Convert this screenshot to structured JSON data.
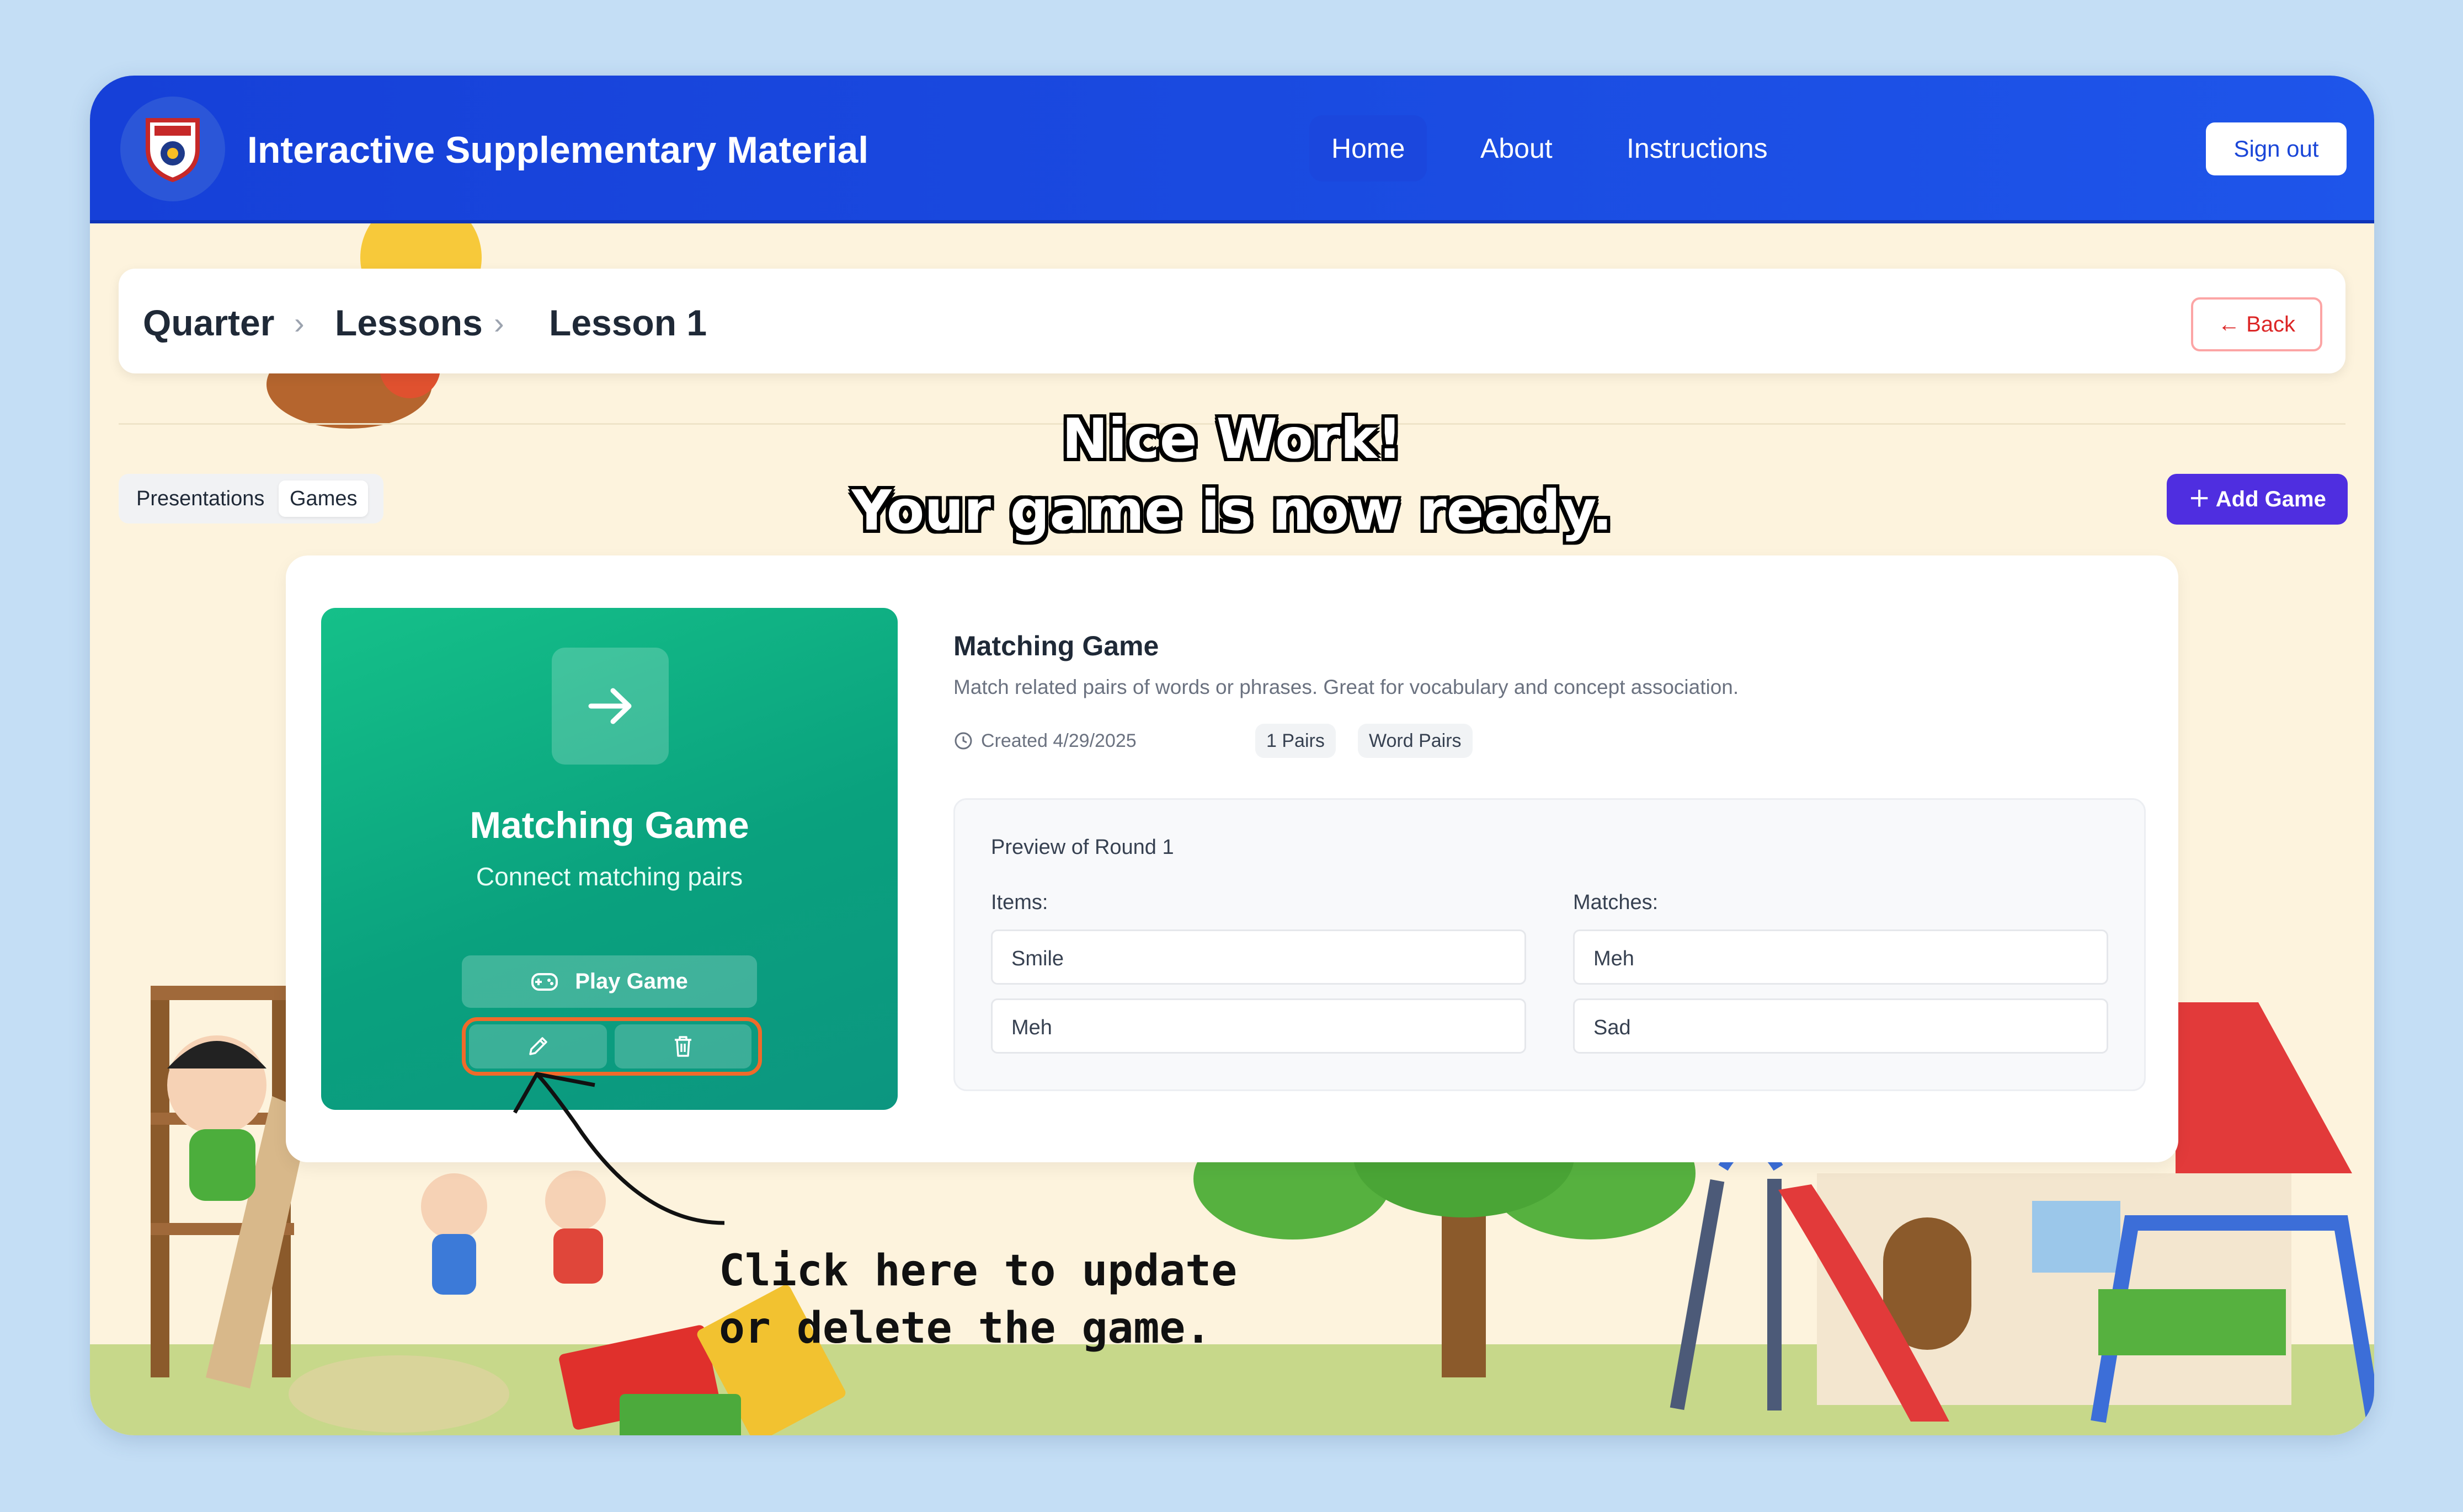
{
  "header": {
    "app_title": "Interactive Supplementary Material",
    "nav": [
      "Home",
      "About",
      "Instructions"
    ],
    "sign_out": "Sign out"
  },
  "breadcrumb": {
    "items": [
      "Quarter",
      "Lessons",
      "Lesson 1"
    ],
    "separator": "›",
    "back_label": "Back"
  },
  "tabs": [
    "Presentations",
    "Games"
  ],
  "active_tab": "Games",
  "add_game_label": "Add Game",
  "overlay": {
    "line1": "Nice Work!",
    "line2": "Your game is now ready."
  },
  "game_tile": {
    "title": "Matching Game",
    "subtitle": "Connect matching pairs",
    "play_label": "Play Game"
  },
  "game_info": {
    "title": "Matching Game",
    "description": "Match related pairs of words or phrases. Great for vocabulary and concept association.",
    "created": "Created 4/29/2025",
    "badges": [
      "1 Pairs",
      "Word Pairs"
    ]
  },
  "preview": {
    "title": "Preview of Round 1",
    "items_label": "Items:",
    "matches_label": "Matches:",
    "items": [
      "Smile",
      "Meh"
    ],
    "matches": [
      "Meh",
      "Sad"
    ]
  },
  "annotation": {
    "line1": "Click here to update",
    "line2": "or delete the game."
  },
  "colors": {
    "header_blue": "#1a46d8",
    "tile_green": "#0aa17e",
    "add_game_purple": "#4f2ee0",
    "highlight_orange": "#f06a2a",
    "back_red": "#dc2626"
  }
}
